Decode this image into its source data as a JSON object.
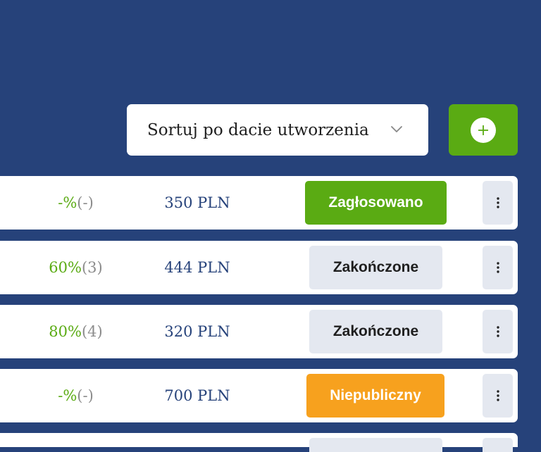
{
  "sort": {
    "label": "Sortuj po dacie utworzenia",
    "icon": "chevron-down-icon"
  },
  "add_button": {
    "icon": "plus-icon",
    "color": "#5aab13"
  },
  "colors": {
    "background": "#26427a",
    "green": "#5aab13",
    "orange": "#f7a11e",
    "neutral": "#e4e8f0",
    "price": "#26427a"
  },
  "rows": [
    {
      "percent": "-%",
      "count": "(-)",
      "price": "350 PLN",
      "status": "Zagłosowano",
      "status_style": "green"
    },
    {
      "percent": "60%",
      "count": "(3)",
      "price": "444 PLN",
      "status": "Zakończone",
      "status_style": "gray"
    },
    {
      "percent": "80%",
      "count": "(4)",
      "price": "320 PLN",
      "status": "Zakończone",
      "status_style": "gray"
    },
    {
      "percent": "-%",
      "count": "(-)",
      "price": "700 PLN",
      "status": "Niepubliczny",
      "status_style": "orange"
    }
  ]
}
